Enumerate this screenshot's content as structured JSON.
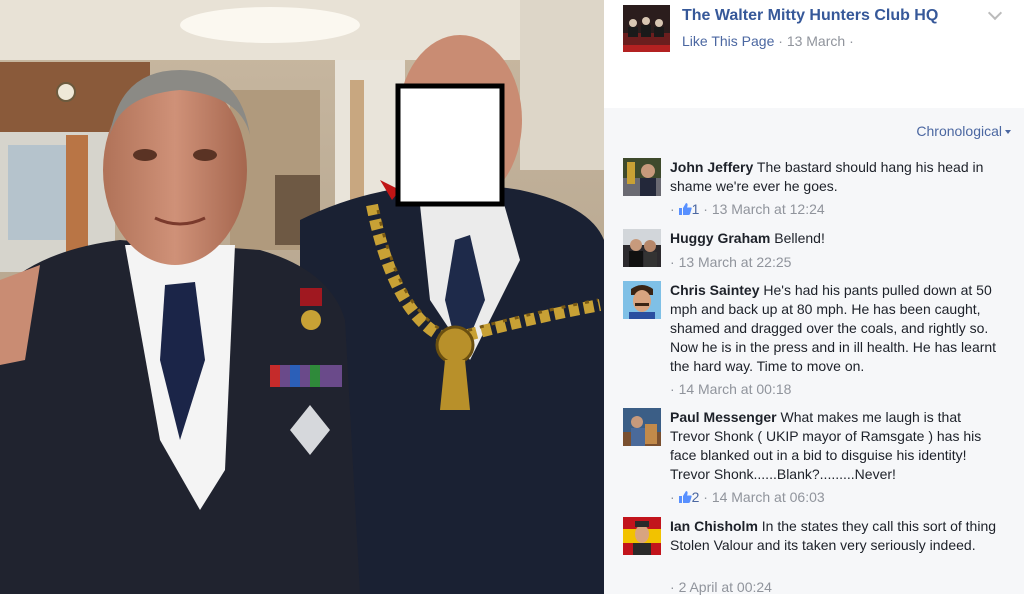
{
  "page": {
    "name": "The Walter Mitty Hunters Club HQ",
    "like_label": "Like This Page",
    "date": "13 March"
  },
  "sort_label": "Chronological",
  "comments": [
    {
      "author": "John Jeffery",
      "text": "The bastard should hang his head in shame we're ever he goes.",
      "likes": "1",
      "time": "13 March at 12:24"
    },
    {
      "author": "Huggy Graham",
      "text": "Bellend!",
      "likes": "",
      "time": "13 March at 22:25"
    },
    {
      "author": "Chris Saintey",
      "text": "He's had his pants pulled down at 50 mph and back up at 80 mph. He has been caught, shamed and dragged over the coals, and rightly so. Now he is in the press and in ill health. He has learnt the hard way. Time to move on.",
      "likes": "",
      "time": "14 March at 00:18"
    },
    {
      "author": "Paul Messenger",
      "text": "What makes me laugh is that Trevor Shonk ( UKIP mayor of Ramsgate ) has his face blanked out in a bid to disguise his identity! Trevor Shonk......Blank?.........Never!",
      "likes": "2",
      "time": "14 March at 06:03"
    },
    {
      "author": "Ian Chisholm",
      "text": "In the states they call this sort of thing Stolen Valour and its taken very seriously indeed.",
      "likes": "",
      "time": "2 April at 00:24"
    }
  ],
  "icons": {
    "page_menu": "chevron-down-icon",
    "like": "thumbs-up-icon",
    "sort": "caret-down-icon"
  }
}
